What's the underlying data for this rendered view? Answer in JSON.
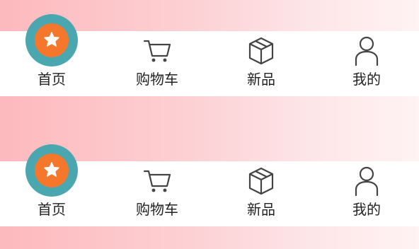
{
  "tabbars": [
    {
      "tabs": [
        {
          "label": "首页",
          "icon": "star-icon"
        },
        {
          "label": "购物车",
          "icon": "cart-icon"
        },
        {
          "label": "新品",
          "icon": "cube-icon"
        },
        {
          "label": "我的",
          "icon": "user-icon"
        }
      ]
    },
    {
      "tabs": [
        {
          "label": "首页",
          "icon": "star-icon"
        },
        {
          "label": "购物车",
          "icon": "cart-icon"
        },
        {
          "label": "新品",
          "icon": "cube-icon"
        },
        {
          "label": "我的",
          "icon": "user-icon"
        }
      ]
    }
  ],
  "colors": {
    "home_ring": "#4aa7b0",
    "home_fill": "#f5772c",
    "icon_stroke": "#444444"
  }
}
